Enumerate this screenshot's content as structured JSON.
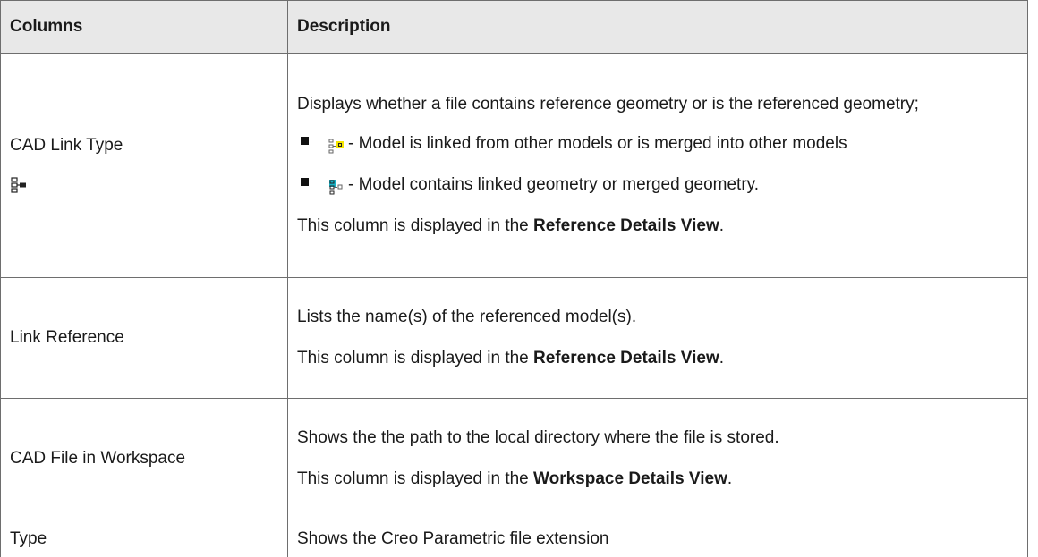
{
  "headers": {
    "col1": "Columns",
    "col2": "Description"
  },
  "rows": [
    {
      "name": "CAD Link Type",
      "icon": "cad-link-type-icon",
      "desc": "Displays whether a file contains reference geometry or is the referenced geometry;",
      "bullets": [
        {
          "icon": "linked-from-icon",
          "text": "- Model is linked from other models or is merged into other models"
        },
        {
          "icon": "contains-linked-icon",
          "text": "- Model contains linked geometry or merged geometry."
        }
      ],
      "note_prefix": "This column is displayed in the ",
      "note_bold": "Reference Details View",
      "note_suffix": "."
    },
    {
      "name": "Link Reference",
      "desc": "Lists the name(s) of the referenced model(s).",
      "note_prefix": "This column is displayed in the ",
      "note_bold": "Reference Details View",
      "note_suffix": "."
    },
    {
      "name": "CAD File in Workspace",
      "desc": "Shows the the path to the local directory where the file is stored.",
      "note_prefix": "This column is displayed in the ",
      "note_bold": "Workspace Details View",
      "note_suffix": "."
    },
    {
      "name": "Type",
      "desc": "Shows the Creo Parametric file extension"
    }
  ],
  "colors": {
    "highlight_yellow": "#f5e600",
    "highlight_cyan": "#19b3c8",
    "border": "#6e6e6e",
    "header_bg": "#e8e8e8"
  }
}
